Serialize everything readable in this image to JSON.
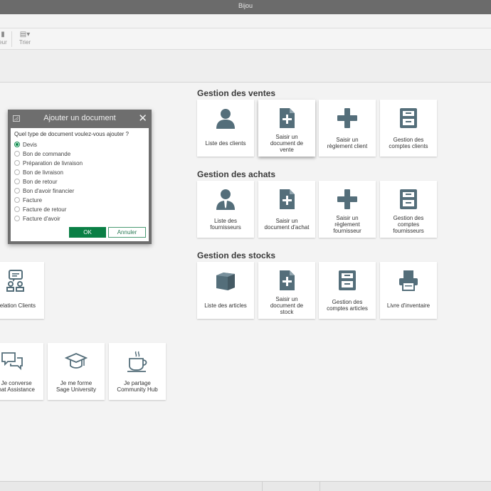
{
  "window": {
    "title": "Bijou"
  },
  "toolbar": {
    "items": [
      {
        "label": "eur"
      },
      {
        "label": "Trier",
        "icon": "sort-icon"
      }
    ]
  },
  "sections": {
    "ventes": {
      "title": "Gestion des ventes",
      "tiles": [
        {
          "label": "Liste des clients",
          "icon": "client-icon"
        },
        {
          "label": "Saisir un\ndocument de\nvente",
          "icon": "document-add-icon"
        },
        {
          "label": "Saisir un\nrèglement client",
          "icon": "plus-icon"
        },
        {
          "label": "Gestion des\ncomptes clients",
          "icon": "cabinet-icon"
        }
      ]
    },
    "achats": {
      "title": "Gestion des achats",
      "tiles": [
        {
          "label": "Liste des\nfournisseurs",
          "icon": "supplier-icon"
        },
        {
          "label": "Saisir un\ndocument d'achat",
          "icon": "document-add-icon"
        },
        {
          "label": "Saisir un\nrèglement\nfournisseur",
          "icon": "plus-icon"
        },
        {
          "label": "Gestion des\ncomptes\nfournisseurs",
          "icon": "cabinet-icon"
        }
      ]
    },
    "stocks": {
      "title": "Gestion des stocks",
      "tiles": [
        {
          "label": "Liste des articles",
          "icon": "box-icon"
        },
        {
          "label": "Saisir un\ndocument de\nstock",
          "icon": "document-add-icon"
        },
        {
          "label": "Gestion des\ncomptes articles",
          "icon": "cabinet-icon"
        },
        {
          "label": "Livre d'inventaire",
          "icon": "printer-icon"
        }
      ]
    }
  },
  "left_tiles": {
    "relation": {
      "label": "elation Clients",
      "icon": "relation-icon"
    },
    "chat": {
      "label": "Je converse\nhat Assistance",
      "icon": "chat-icon"
    },
    "university": {
      "label": "Je me forme\nSage University",
      "icon": "graduation-cap-icon"
    },
    "community": {
      "label": "Je partage\nCommunity Hub",
      "icon": "coffee-cup-icon"
    }
  },
  "dialog": {
    "title": "Ajouter un document",
    "question": "Quel type de document voulez-vous ajouter ?",
    "options": [
      "Devis",
      "Bon de commande",
      "Préparation de livraison",
      "Bon de livraison",
      "Bon de retour",
      "Bon d'avoir financier",
      "Facture",
      "Facture de retour",
      "Facture d'avoir"
    ],
    "selected": "Devis",
    "ok_label": "OK",
    "cancel_label": "Annuler"
  },
  "colors": {
    "icon": "#546e7a",
    "accent": "#0a7f45",
    "titlebar": "#6b6b6b"
  }
}
